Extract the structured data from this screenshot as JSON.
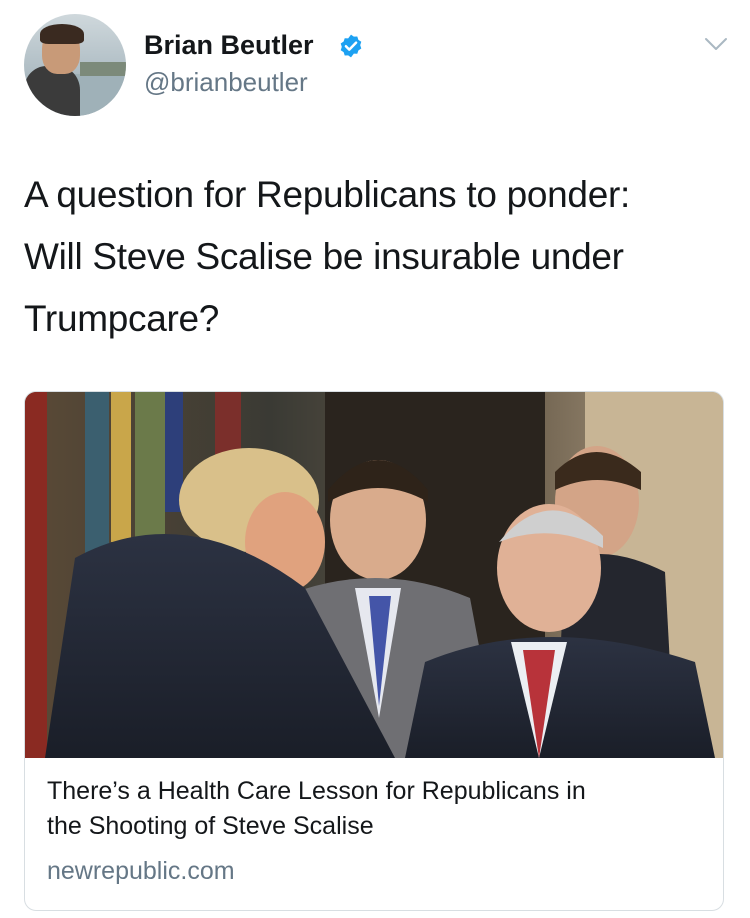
{
  "author": {
    "name": "Brian Beutler",
    "handle": "@brianbeutler",
    "verified": true,
    "avatar_icon": "profile-photo"
  },
  "tweet": {
    "lines": [
      "A question for Republicans to ponder:",
      "Will Steve Scalise be insurable under",
      "Trumpcare?"
    ]
  },
  "card": {
    "title_lines": [
      "There’s a Health Care Lesson for Republicans in",
      "the Shooting of Steve Scalise"
    ],
    "domain": "newrepublic.com",
    "image_icon": "news-photo"
  },
  "icons": {
    "verified": "verified-badge-icon",
    "menu": "chevron-down-icon"
  },
  "colors": {
    "verified_blue": "#1da1f2",
    "secondary_text": "#657786",
    "primary_text": "#14171a",
    "card_border": "#d8dee2"
  }
}
